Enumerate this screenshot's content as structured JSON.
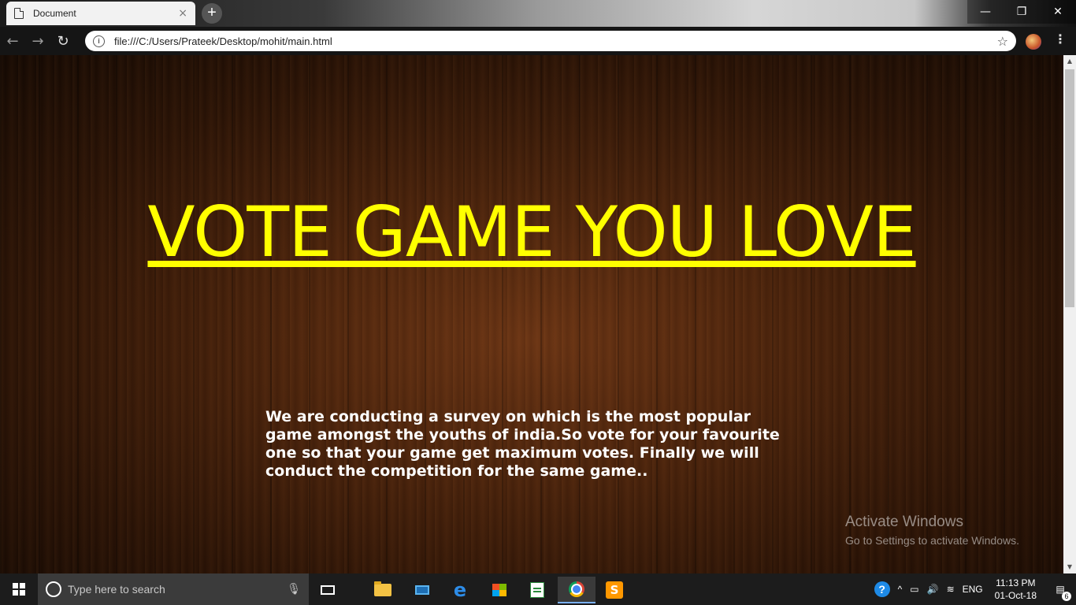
{
  "browser": {
    "tab_title": "Document",
    "tab_close": "×",
    "new_tab": "+",
    "url": "file:///C:/Users/Prateek/Desktop/mohit/main.html",
    "back": "←",
    "forward": "→",
    "reload": "↻",
    "star": "☆",
    "info": "i",
    "menu": "⋮",
    "window_controls": {
      "minimize": "—",
      "restore": "❐",
      "close": "✕"
    }
  },
  "page": {
    "headline": "VOTE GAME YOU LOVE",
    "intro": "We are conducting a survey on which is the most popular game amongst the youths of india.So vote for your favourite one so that your game get maximum votes. Finally we will conduct the competition for the same game..",
    "colors": {
      "headline": "#ffff00",
      "intro": "#ffffff"
    }
  },
  "watermark": {
    "title": "Activate Windows",
    "subtitle": "Go to Settings to activate Windows."
  },
  "taskbar": {
    "search_placeholder": "Type here to search",
    "mic": "🎙",
    "help": "?",
    "tray_up": "^",
    "battery": "▭",
    "volume": "🔊",
    "wifi": "≋",
    "language": "ENG",
    "time": "11:13 PM",
    "date": "01-Oct-18",
    "notifications": "▤",
    "notification_count": "6",
    "sublime_letter": "S",
    "edge_letter": "e"
  }
}
